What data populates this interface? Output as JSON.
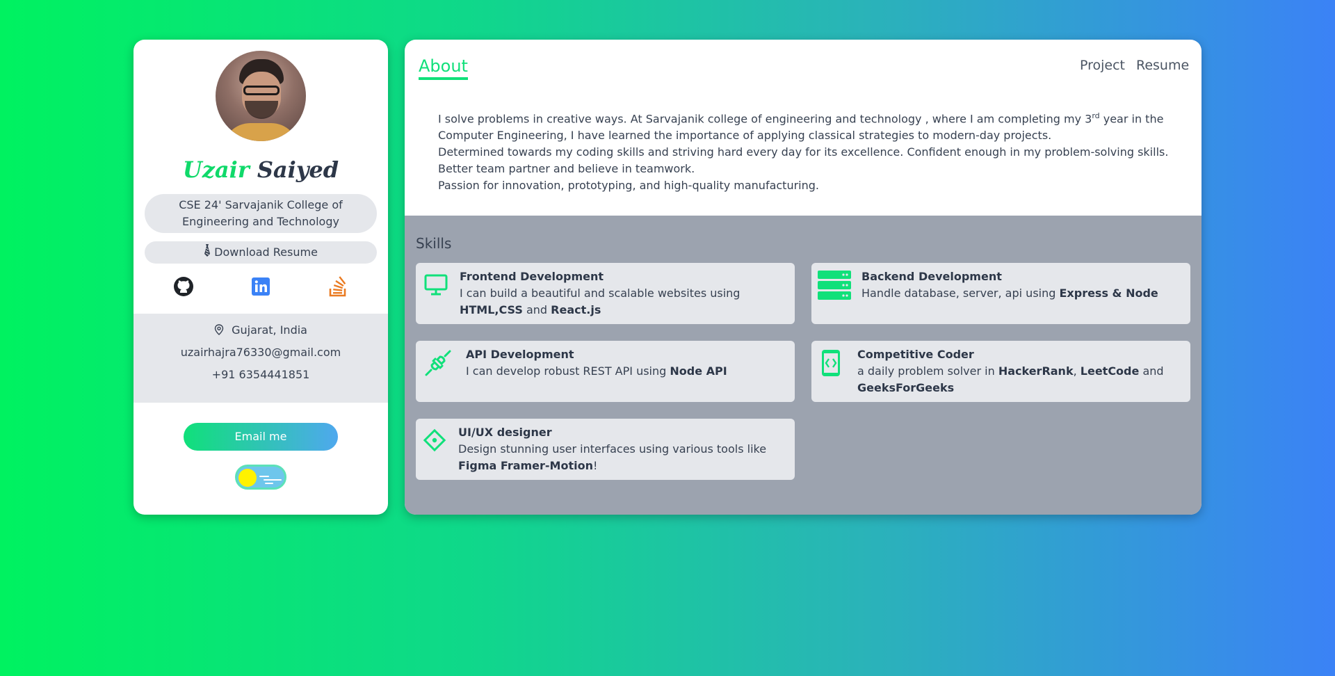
{
  "profile": {
    "first_name": "Uzair",
    "last_name": "Saiyed",
    "college": "CSE 24' Sarvajanik College of Engineering and Technology",
    "download_label": "Download Resume",
    "download_icon": "tie-icon",
    "socials": [
      "github-icon",
      "linkedin-icon",
      "stackoverflow-icon"
    ],
    "location": "Gujarat, India",
    "email": "uzairhajra76330@gmail.com",
    "phone": "+91 6354441851",
    "email_button": "Email me"
  },
  "nav": {
    "active_tab": "About",
    "tabs": [
      "Project",
      "Resume"
    ]
  },
  "about": {
    "line1_a": "I solve problems in creative ways. At Sarvajanik college of engineering and technology , where I am completing my 3",
    "line1_sup": "rd",
    "line1_b": " year in the Computer Engineering, I have learned the importance of applying classical strategies to modern-day projects.",
    "line2": "Determined towards my coding skills and striving hard every day for its excellence. Confident enough in my problem-solving skills.",
    "line3": "Better team partner and believe in teamwork.",
    "line4": "Passion for innovation, prototyping, and high-quality manufacturing."
  },
  "skills": {
    "title": "Skills",
    "items": [
      {
        "title": "Frontend Development",
        "text_a": "I can build a beautiful and scalable websites using ",
        "bold1": "HTML,CSS",
        "text_b": " and ",
        "bold2": "React.js",
        "text_c": "",
        "icon": "monitor-icon"
      },
      {
        "title": "Backend Development",
        "text_a": "Handle database, server, api using ",
        "bold1": "Express & Node",
        "text_b": "",
        "bold2": "",
        "text_c": "",
        "icon": "server-icon"
      },
      {
        "title": "API Development",
        "text_a": "I can develop robust REST API using ",
        "bold1": "Node API",
        "text_b": "",
        "bold2": "",
        "text_c": "",
        "icon": "plug-icon"
      },
      {
        "title": "Competitive Coder",
        "text_a": "a daily problem solver in ",
        "bold1": "HackerRank",
        "text_b": ", ",
        "bold2": "LeetCode",
        "text_c": " and ",
        "bold3": "GeeksForGeeks",
        "icon": "code-phone-icon"
      },
      {
        "title": "UI/UX designer",
        "text_a": "Design stunning user interfaces using various tools like ",
        "bold1": "Figma Framer-Motion",
        "text_b": "!",
        "bold2": "",
        "text_c": "",
        "icon": "diamond-icon"
      }
    ]
  },
  "colors": {
    "accent_green": "#10e07a",
    "gradient_start": "#00f260",
    "gradient_end": "#3b82f6",
    "skills_bg": "#9ca3af",
    "card_bg": "#e5e7eb"
  }
}
